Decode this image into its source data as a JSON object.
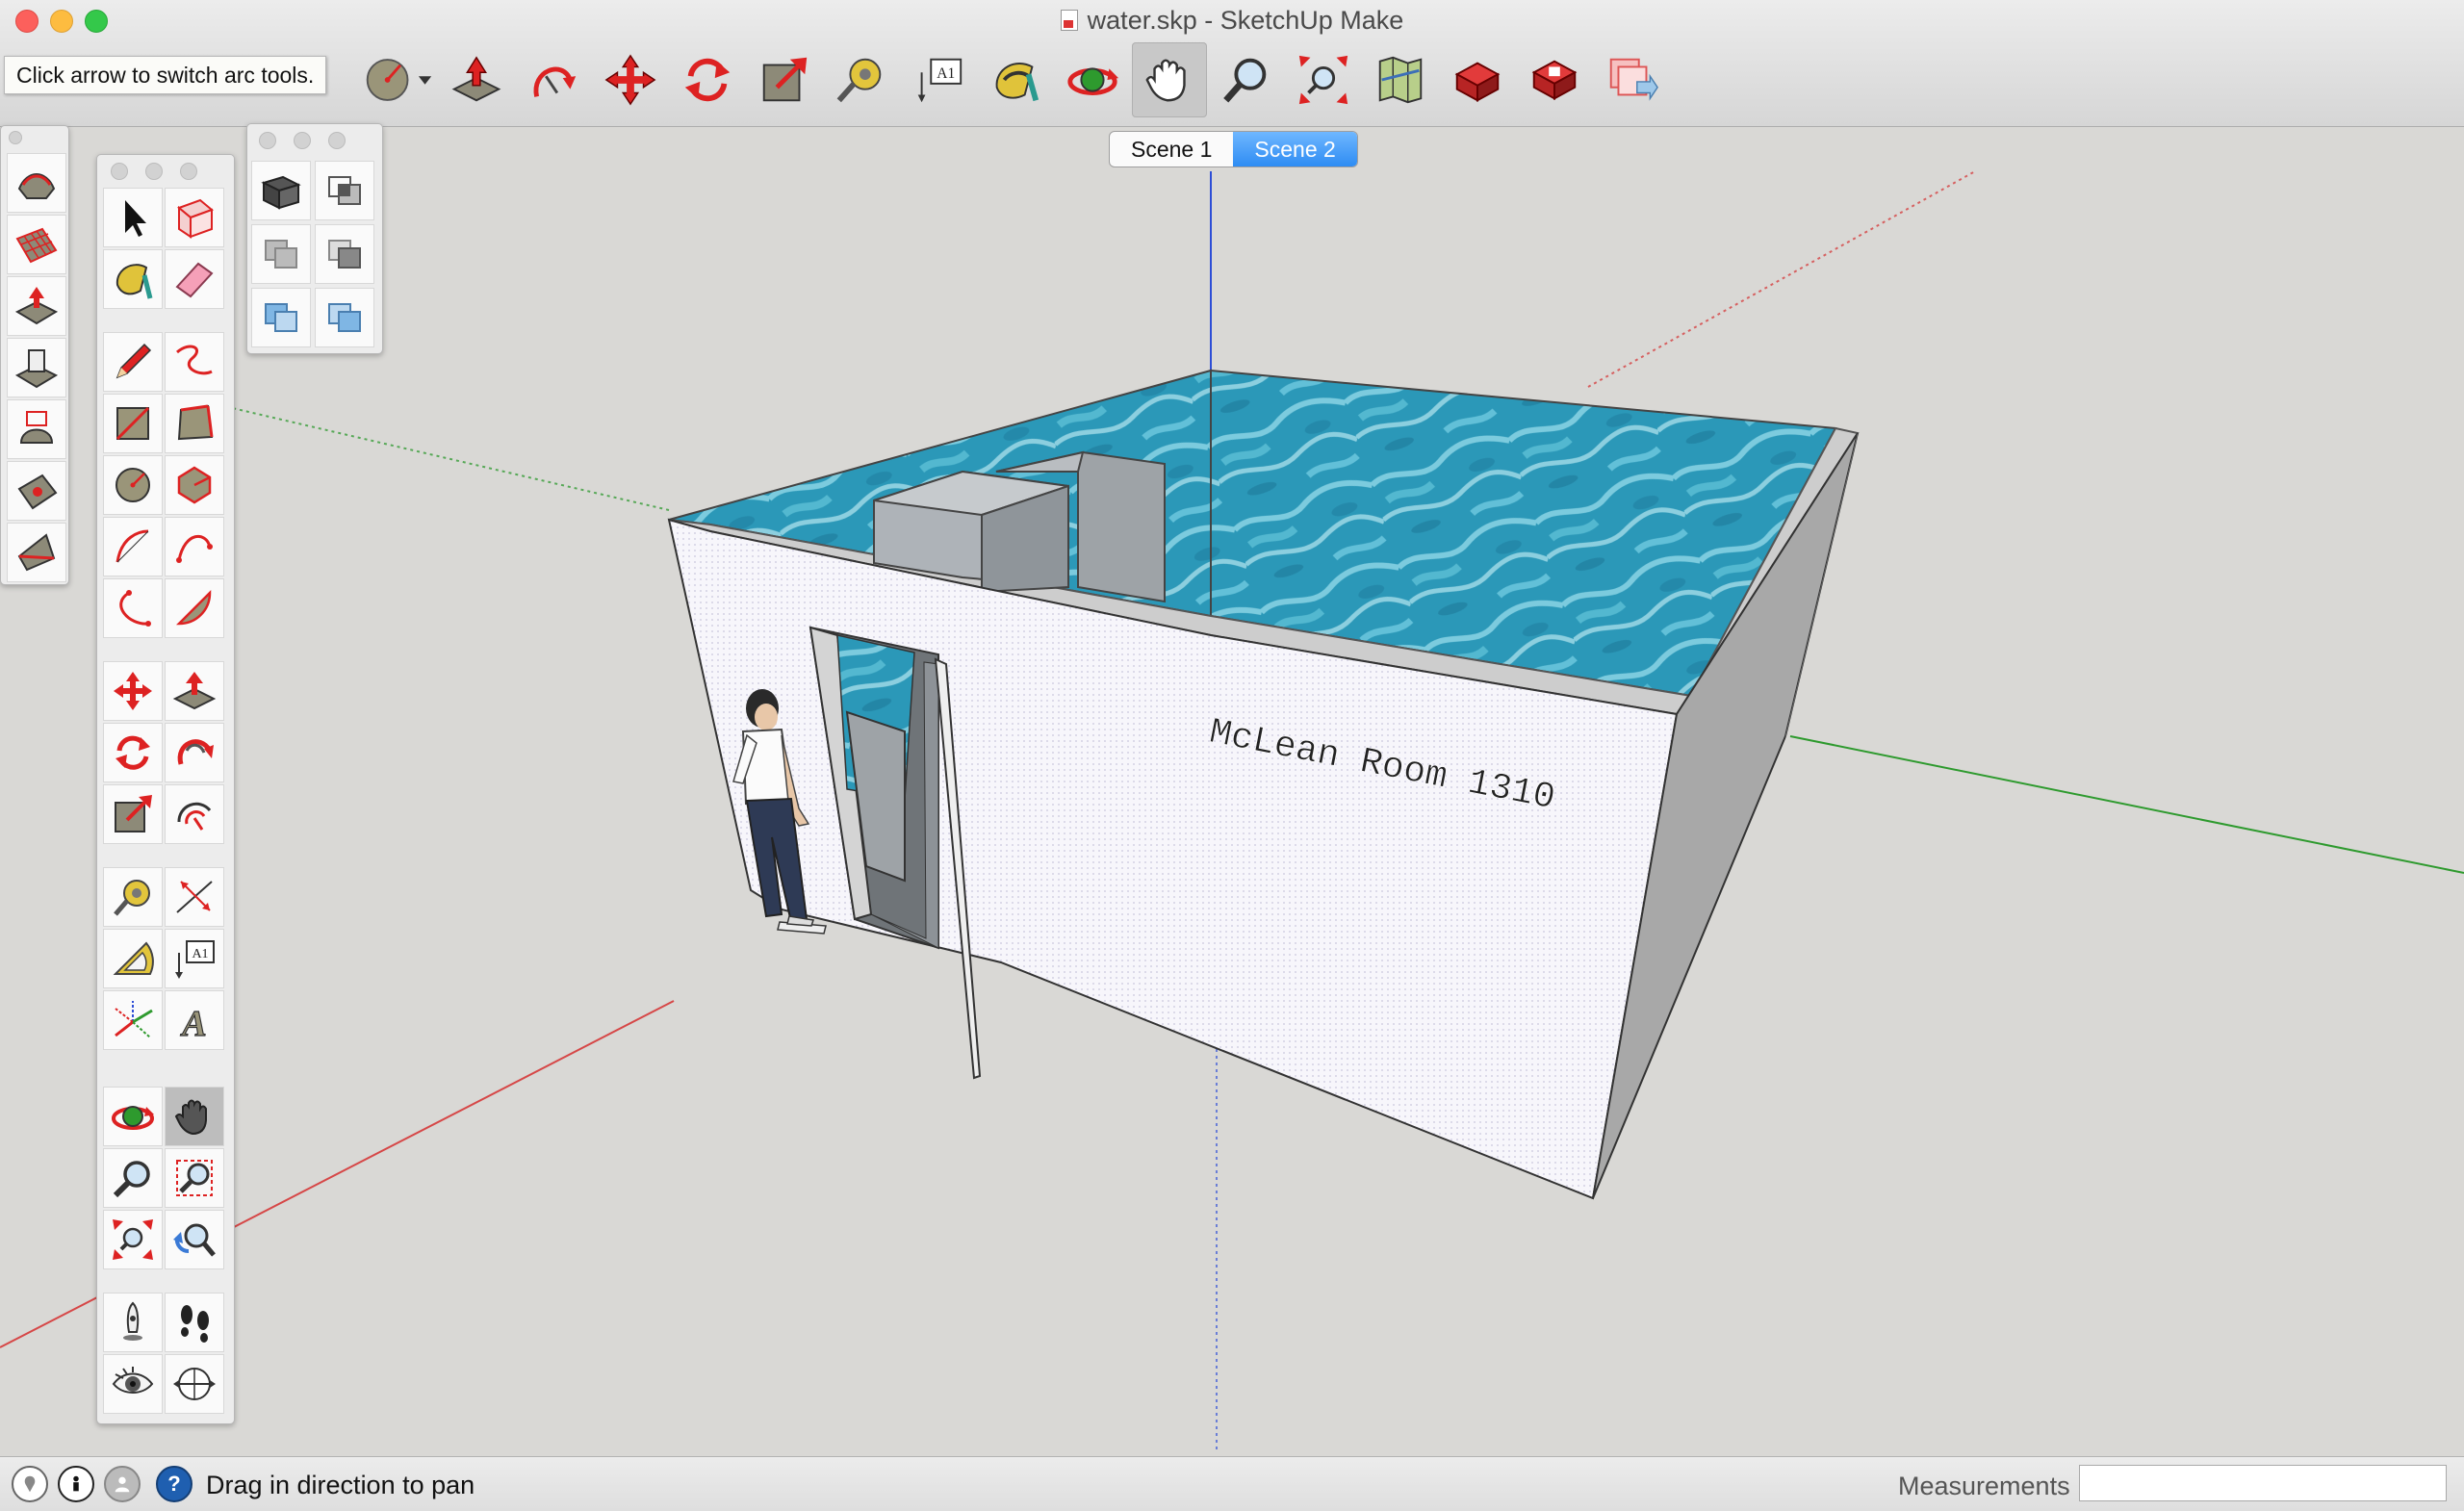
{
  "window": {
    "title": "water.skp - SketchUp Make"
  },
  "tooltip": {
    "text": "Click arrow to switch arc tools."
  },
  "toolbar": {
    "items": [
      {
        "name": "arc-tool-dropdown",
        "icon": "arc-icon"
      },
      {
        "name": "push-pull",
        "icon": "push-pull-icon"
      },
      {
        "name": "follow-me",
        "icon": "follow-me-icon"
      },
      {
        "name": "move",
        "icon": "move-icon"
      },
      {
        "name": "rotate",
        "icon": "rotate-icon"
      },
      {
        "name": "scale",
        "icon": "scale-icon"
      },
      {
        "name": "tape-measure",
        "icon": "tape-measure-icon"
      },
      {
        "name": "text",
        "icon": "text-icon"
      },
      {
        "name": "paint-bucket",
        "icon": "paint-bucket-icon"
      },
      {
        "name": "orbit",
        "icon": "orbit-icon"
      },
      {
        "name": "pan",
        "icon": "pan-hand-icon",
        "active": true
      },
      {
        "name": "zoom",
        "icon": "zoom-icon"
      },
      {
        "name": "zoom-extents",
        "icon": "zoom-extents-icon"
      },
      {
        "name": "add-location",
        "icon": "map-icon"
      },
      {
        "name": "3d-warehouse",
        "icon": "warehouse-icon"
      },
      {
        "name": "extension-warehouse",
        "icon": "extension-warehouse-icon"
      },
      {
        "name": "send-to-layout",
        "icon": "layout-icon"
      }
    ],
    "text_tool_glyph": "A1"
  },
  "scenes": {
    "tabs": [
      "Scene 1",
      "Scene 2"
    ],
    "selected": "Scene 2"
  },
  "model": {
    "wall_text": "McLean Room 1310"
  },
  "palettes": {
    "large_tool_set": {
      "text_tool_glyph": "A1",
      "text_3d_glyph": "A"
    }
  },
  "statusbar": {
    "message": "Drag in direction to pan",
    "measurements_label": "Measurements",
    "measurements_value": ""
  },
  "colors": {
    "accent_blue": "#3a8ff4",
    "water": "#2f9bbd",
    "axis_red": "#c43434",
    "axis_green": "#2e9a2e",
    "axis_blue": "#2e4ed6"
  }
}
